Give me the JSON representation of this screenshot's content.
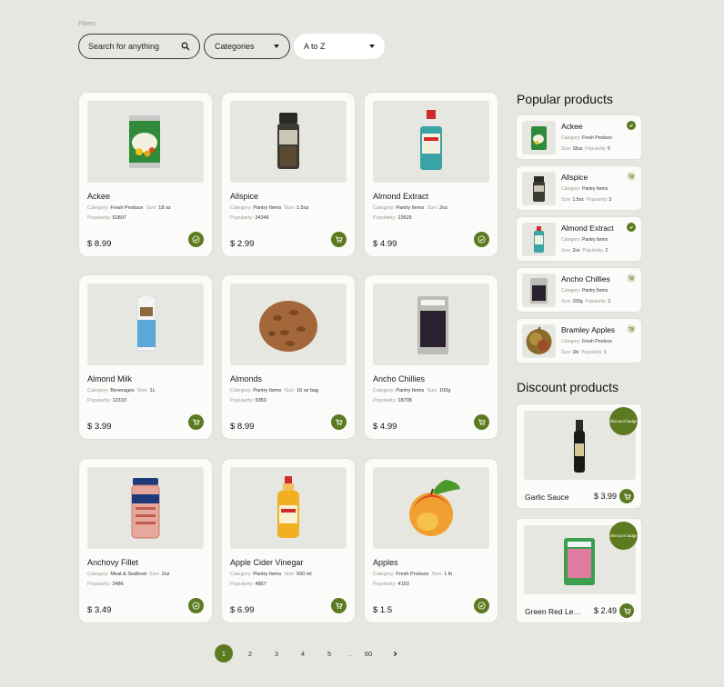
{
  "filters": {
    "label": "Filters:",
    "search_placeholder": "Search for anything",
    "category_value": "Categories",
    "sort_value": "A to Z"
  },
  "meta_labels": {
    "category": "Category:",
    "size": "Size:",
    "popularity": "Popularity:"
  },
  "products": [
    {
      "name": "Ackee",
      "category": "Fresh Produce",
      "size": "18 oz",
      "popularity": "52807",
      "price": "$ 8.99",
      "state": "added",
      "icon": "check-icon"
    },
    {
      "name": "Allspice",
      "category": "Pantry Items",
      "size": "1.5oz",
      "popularity": "34346",
      "price": "$ 2.99",
      "state": "cart",
      "icon": "cart-icon"
    },
    {
      "name": "Almond Extract",
      "category": "Pantry Items",
      "size": "2oz",
      "popularity": "23625",
      "price": "$ 4.99",
      "state": "added",
      "icon": "check-icon"
    },
    {
      "name": "Almond Milk",
      "category": "Beverages",
      "size": "1L",
      "popularity": "12310",
      "price": "$ 3.99",
      "state": "cart",
      "icon": "cart-icon"
    },
    {
      "name": "Almonds",
      "category": "Pantry Items",
      "size": "16 oz bag",
      "popularity": "9350",
      "price": "$ 8.99",
      "state": "cart",
      "icon": "cart-icon"
    },
    {
      "name": "Ancho Chillies",
      "category": "Pantry Items",
      "size": "100g",
      "popularity": "18708",
      "price": "$ 4.99",
      "state": "cart",
      "icon": "cart-icon"
    },
    {
      "name": "Anchovy Fillet",
      "category": "Meat & Seafood",
      "size": "2oz",
      "popularity": "3486",
      "price": "$ 3.49",
      "state": "added",
      "icon": "check-icon"
    },
    {
      "name": "Apple Cider Vinegar",
      "category": "Pantry Items",
      "size": "500 ml",
      "popularity": "4857",
      "price": "$ 6.99",
      "state": "cart",
      "icon": "cart-icon"
    },
    {
      "name": "Apples",
      "category": "Fresh Produce",
      "size": "1 lb",
      "popularity": "4193",
      "price": "$ 1.5",
      "state": "added",
      "icon": "check-icon"
    }
  ],
  "popular": {
    "title": "Popular products",
    "items": [
      {
        "name": "Ackee",
        "category": "Fresh Produce",
        "size": "18oz",
        "popularity": "5",
        "state": "added",
        "icon": "check-icon"
      },
      {
        "name": "Allspice",
        "category": "Pantry Items",
        "size": "1.5oz",
        "popularity": "3",
        "state": "cart",
        "icon": "cart-icon"
      },
      {
        "name": "Almond Extract",
        "category": "Pantry Items",
        "size": "2oz",
        "popularity": "2",
        "state": "added",
        "icon": "check-icon"
      },
      {
        "name": "Ancho Chillies",
        "category": "Pantry Items",
        "size": "100g",
        "popularity": "1",
        "state": "cart",
        "icon": "cart-icon"
      },
      {
        "name": "Bramley Apples",
        "category": "Fresh Produce",
        "size": "1lb",
        "popularity": "1",
        "state": "cart",
        "icon": "cart-icon"
      }
    ]
  },
  "discount": {
    "title": "Discount products",
    "badge": "discount badge",
    "items": [
      {
        "name": "Garlic Sauce",
        "price": "$ 3.99",
        "icon": "cart-icon"
      },
      {
        "name": "Green Red Lentils",
        "price": "$ 2.49",
        "icon": "cart-icon"
      }
    ]
  },
  "pagination": {
    "pages": [
      "1",
      "2",
      "3",
      "4",
      "5"
    ],
    "ellipsis": "...",
    "last": "60",
    "current": "1"
  },
  "colors": {
    "accent": "#5c7a1f",
    "background": "#e7e7e2",
    "card": "#fbfbf9"
  }
}
